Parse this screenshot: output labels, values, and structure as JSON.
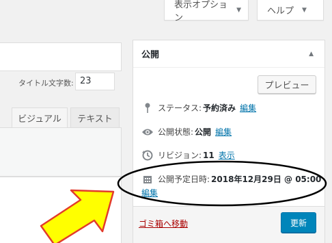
{
  "screen_options": {
    "label": "表示オプション",
    "caret": "▼"
  },
  "help": {
    "label": "ヘルプ",
    "caret": "▼"
  },
  "editor": {
    "word_count_label": "タイトル文字数:",
    "word_count_value": "23",
    "tabs": [
      {
        "label": "ビジュアル"
      },
      {
        "label": "テキスト"
      }
    ]
  },
  "publish": {
    "title": "公開",
    "toggle": "▲",
    "preview_label": "プレビュー",
    "status": {
      "label": "ステータス:",
      "value": "予約済み",
      "edit": "編集",
      "icon": "pin-icon"
    },
    "visibility": {
      "label": "公開状態:",
      "value": "公開",
      "edit": "編集",
      "icon": "eye-icon"
    },
    "revisions": {
      "label": "リビジョン:",
      "value": "11",
      "link": "表示",
      "icon": "history-icon"
    },
    "schedule": {
      "label": "公開予定日時:",
      "value": "2018年12月29日 @ 05:00",
      "edit": "編集",
      "icon": "calendar-icon"
    },
    "trash_label": "ゴミ箱へ移動",
    "update_label": "更新"
  },
  "annotation": {
    "ellipse_color": "#000000",
    "arrow_fill": "#ffff00",
    "arrow_stroke": "#e23b2b"
  }
}
